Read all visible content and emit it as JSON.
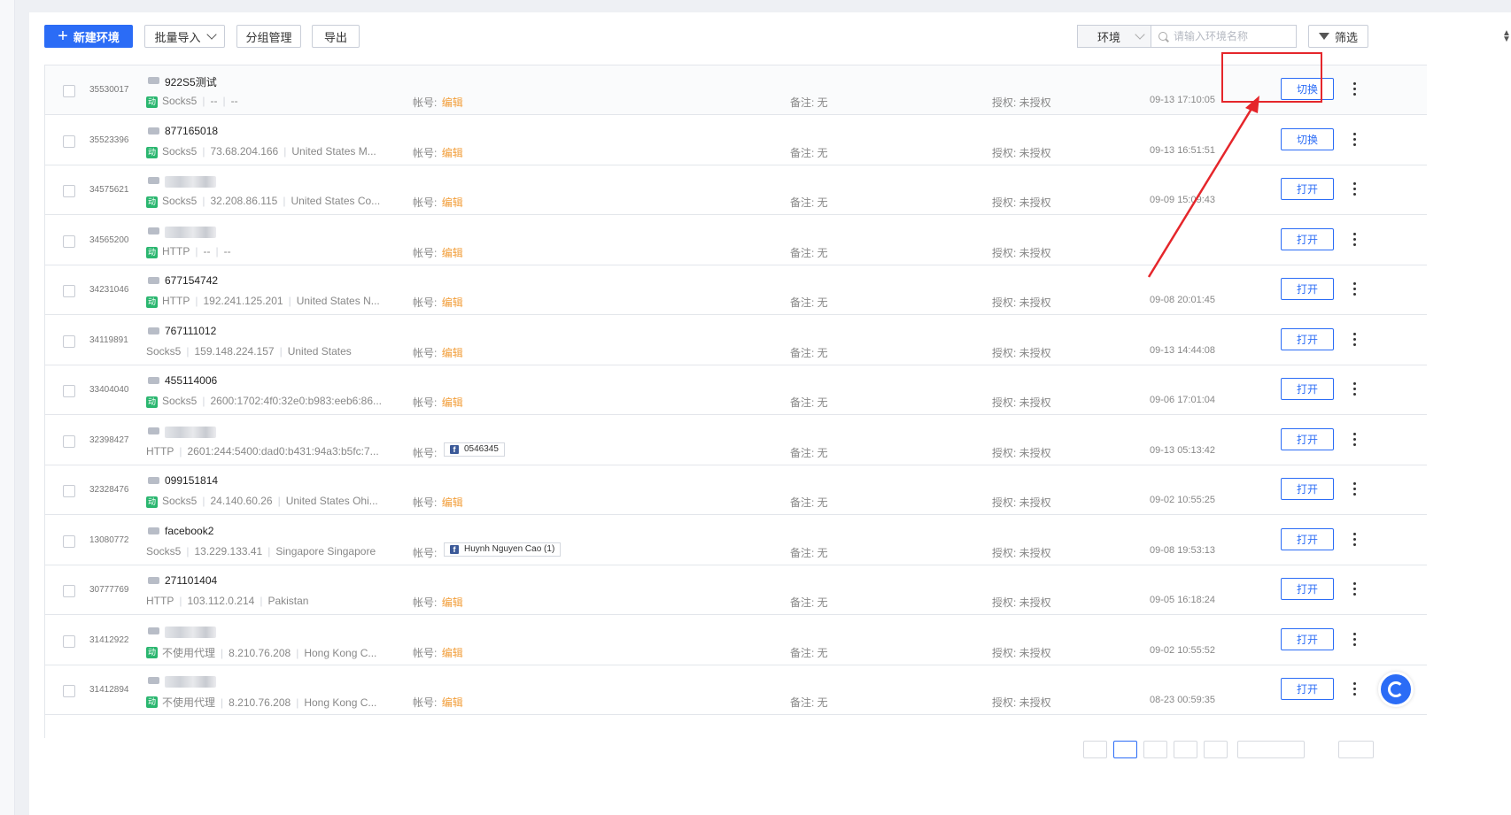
{
  "toolbar": {
    "new_env_label": "新建环境",
    "batch_import_label": "批量导入",
    "group_manage_label": "分组管理",
    "export_label": "导出",
    "env_select_value": "环境",
    "search_placeholder": "请输入环境名称",
    "filter_label": "筛选"
  },
  "labels": {
    "account": "帐号:",
    "edit": "编辑",
    "remark": "备注: 无",
    "auth": "授权: 未授权",
    "dyn_badge": "动"
  },
  "rows": [
    {
      "id": "35530017",
      "name": "922S5测试",
      "blurred": false,
      "dynamic": true,
      "protocol": "Socks5",
      "ip": "--",
      "location": "--",
      "account": null,
      "time": "09-13 17:10:05",
      "action": "切换"
    },
    {
      "id": "35523396",
      "name": "877165018",
      "blurred": false,
      "dynamic": true,
      "protocol": "Socks5",
      "ip": "73.68.204.166",
      "location": "United States M...",
      "account": null,
      "time": "09-13 16:51:51",
      "action": "切换"
    },
    {
      "id": "34575621",
      "name": "",
      "blurred": true,
      "dynamic": true,
      "protocol": "Socks5",
      "ip": "32.208.86.115",
      "location": "United States Co...",
      "account": null,
      "time": "09-09 15:09:43",
      "action": "打开"
    },
    {
      "id": "34565200",
      "name": "",
      "blurred": true,
      "dynamic": true,
      "protocol": "HTTP",
      "ip": "--",
      "location": "--",
      "account": null,
      "time": "",
      "action": "打开"
    },
    {
      "id": "34231046",
      "name": "677154742",
      "blurred": false,
      "dynamic": true,
      "protocol": "HTTP",
      "ip": "192.241.125.201",
      "location": "United States N...",
      "account": null,
      "time": "09-08 20:01:45",
      "action": "打开"
    },
    {
      "id": "34119891",
      "name": "767111012",
      "blurred": false,
      "dynamic": false,
      "protocol": "Socks5",
      "ip": "159.148.224.157",
      "location": "United States",
      "account": null,
      "time": "09-13 14:44:08",
      "action": "打开"
    },
    {
      "id": "33404040",
      "name": "455114006",
      "blurred": false,
      "dynamic": true,
      "protocol": "Socks5",
      "ip": "2600:1702:4f0:32e0:b983:eeb6:86...",
      "location": "",
      "account": null,
      "time": "09-06 17:01:04",
      "action": "打开"
    },
    {
      "id": "32398427",
      "name": "",
      "blurred": true,
      "dynamic": false,
      "protocol": "HTTP",
      "ip": "2601:244:5400:dad0:b431:94a3:b5fc:7...",
      "location": "",
      "account": "0546345",
      "time": "09-13 05:13:42",
      "action": "打开"
    },
    {
      "id": "32328476",
      "name": "099151814",
      "blurred": false,
      "dynamic": true,
      "protocol": "Socks5",
      "ip": "24.140.60.26",
      "location": "United States Ohi...",
      "account": null,
      "time": "09-02 10:55:25",
      "action": "打开"
    },
    {
      "id": "13080772",
      "name": "facebook2",
      "blurred": false,
      "dynamic": false,
      "protocol": "Socks5",
      "ip": "13.229.133.41",
      "location": "Singapore Singapore",
      "account": "Huynh Nguyen Cao  (1)",
      "time": "09-08 19:53:13",
      "action": "打开"
    },
    {
      "id": "30777769",
      "name": "271101404",
      "blurred": false,
      "dynamic": false,
      "protocol": "HTTP",
      "ip": "103.112.0.214",
      "location": "Pakistan",
      "account": null,
      "time": "09-05 16:18:24",
      "action": "打开"
    },
    {
      "id": "31412922",
      "name": "",
      "blurred": true,
      "dynamic": true,
      "protocol": "不使用代理",
      "ip": "8.210.76.208",
      "location": "Hong Kong C...",
      "account": null,
      "time": "09-02 10:55:52",
      "action": "打开"
    },
    {
      "id": "31412894",
      "name": "",
      "blurred": true,
      "dynamic": true,
      "protocol": "不使用代理",
      "ip": "8.210.76.208",
      "location": "Hong Kong C...",
      "account": null,
      "time": "08-23 00:59:35",
      "action": "打开"
    }
  ],
  "colors": {
    "primary": "#2b6cf6",
    "edit_link": "#f29d38",
    "dynamic_badge": "#2ab66f",
    "annotation": "#e5262b"
  }
}
